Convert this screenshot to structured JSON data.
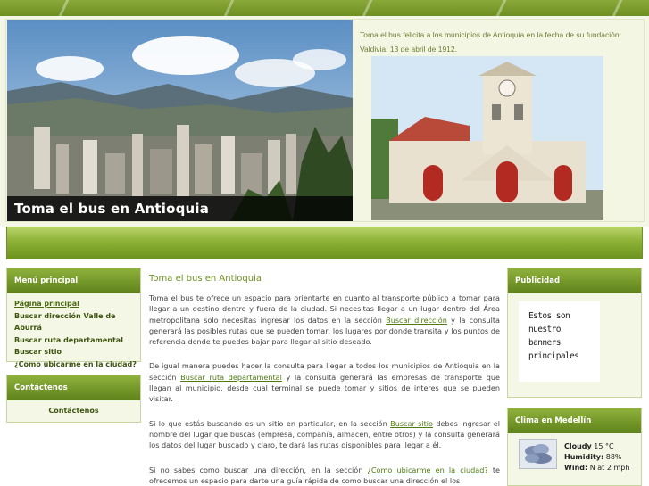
{
  "header": {
    "caption": "Toma el bus en Antioquia",
    "greeting_line1": "Toma el bus felicita a los municipios de Antioquia en la fecha de su fundación:",
    "greeting_line2": "Valdivia, 13 de abril de 1912."
  },
  "menu": {
    "title": "Menú principal",
    "items": [
      {
        "label": "Página principal"
      },
      {
        "label": "Buscar dirección Valle de Aburrá"
      },
      {
        "label": "Buscar ruta departamental"
      },
      {
        "label": "Buscar sitio"
      },
      {
        "label": "¿Como ubicarme en la ciudad?"
      }
    ]
  },
  "contact": {
    "title": "Contáctenos",
    "link": "Contáctenos"
  },
  "main": {
    "title": "Toma el bus en Antioquia",
    "p1_a": "Toma el bus te ofrece un espacio para orientarte en cuanto al transporte público a tomar para llegar a un destino dentro y fuera de la ciudad. Si necesitas llegar a un lugar dentro del Área metropolitana solo necesitas ingresar los datos en la sección ",
    "p1_link": "Buscar dirección",
    "p1_b": " y la consulta generará las posibles rutas que se pueden tomar, los lugares por donde transita y los puntos de referencia donde te puedes bajar para llegar al sitio deseado.",
    "p2_a": "De igual manera puedes hacer la consulta para llegar a todos los municipios de Antioquia en la sección ",
    "p2_link": "Buscar ruta departamental",
    "p2_b": " y la consulta generará las empresas de transporte que llegan al municipio, desde cual terminal se puede tomar y sitios de interes que se pueden visitar.",
    "p3_a": "Si lo que estás buscando es un sitio en particular, en la sección ",
    "p3_link": "Buscar sitio",
    "p3_b": " debes ingresar el nombre del lugar que buscas (empresa, compañía, almacen, entre otros) y la consulta generará los datos del lugar buscado y claro, te dará las rutas disponibles para llegar a él.",
    "p4_a": "Si no sabes como buscar una dirección, en la sección ",
    "p4_link": "¿Como ubicarme en la ciudad?",
    "p4_b": " te ofrecemos un espacio para darte una guía rápida de como buscar una dirección el los"
  },
  "ads": {
    "title": "Publicidad",
    "banner_line1": "Estos son nuestro",
    "banner_line2": "banners",
    "banner_line3": "principales"
  },
  "weather": {
    "title": "Clima en Medellín",
    "condition_label": "Cloudy",
    "temperature": "15 °C",
    "humidity_label": "Humidity:",
    "humidity": "88%",
    "wind_label": "Wind:",
    "wind": "N at 2 mph",
    "icon": "cloudy-icon"
  },
  "colors": {
    "accent": "#6e8f22",
    "header_bg": "#f3f6e3"
  }
}
